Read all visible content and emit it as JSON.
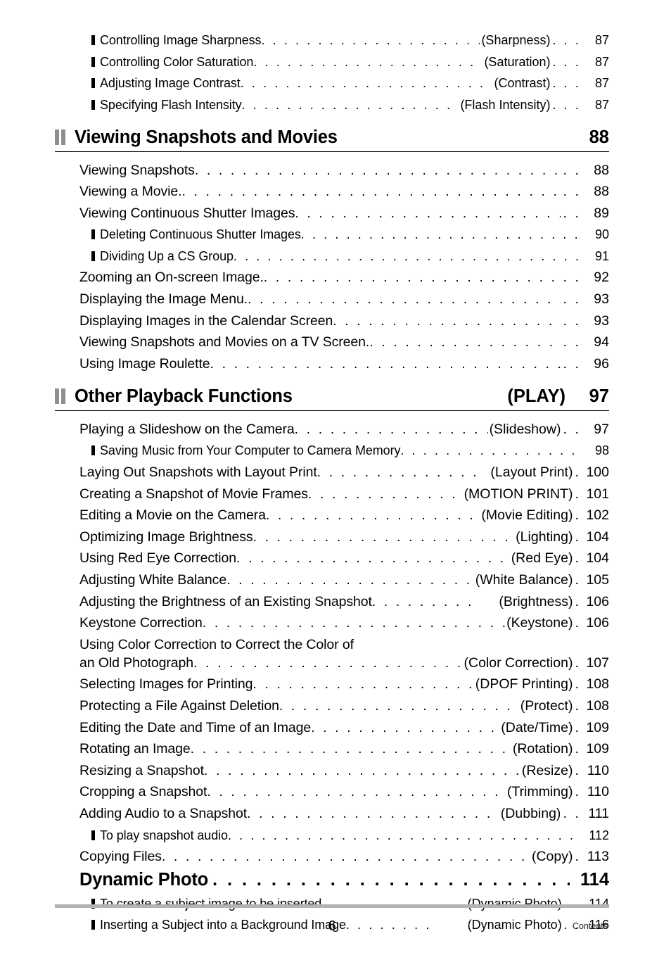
{
  "document": {
    "page_number": "6",
    "footer_label": "Contents"
  },
  "icons": {
    "section_marker": "double-bar-icon",
    "bullet": "filled-square-bullet-icon"
  },
  "colors": {
    "text": "#000000",
    "section_marker": "#8e8e8e",
    "footer_rule": "#b3b3b3",
    "rule": "#000000"
  },
  "top_entries": [
    {
      "label": "Controlling Image Sharpness",
      "ref": "(Sharpness)",
      "page": "87",
      "leader": ". . . . . . . . . . . . . . . . . . . . . . . .",
      "tail": ". . ."
    },
    {
      "label": "Controlling Color Saturation",
      "ref": "(Saturation)",
      "page": "87",
      "leader": ". . . . . . . . . . . . . . . . . . . . . . . . .",
      "tail": ". . ."
    },
    {
      "label": "Adjusting Image Contrast",
      "ref": "(Contrast)",
      "page": "87",
      "leader": ". . . . . . . . . . . . . . . . . . . . . . . . . . . . .",
      "tail": ". . ."
    },
    {
      "label": "Specifying Flash Intensity",
      "ref": "(Flash Intensity)",
      "page": "87",
      "leader": ". . . . . . . . . . . . . . . . . . . . . .",
      "tail": ". . ."
    }
  ],
  "sections": [
    {
      "title": "Viewing Snapshots and Movies",
      "ref": "",
      "page": "88",
      "entries": [
        {
          "level": 1,
          "label": "Viewing Snapshots",
          "ref": "",
          "page": "88",
          "leader": ". . . . . . . . . . . . . . . . . . . . . . . . . . . . . . . . . . . . . . . . . . . . . .",
          "tail": ". ."
        },
        {
          "level": 1,
          "label": "Viewing a Movie.",
          "ref": "",
          "page": "88",
          "leader": ". . . . . . . . . . . . . . . . . . . . . . . . . . . . . . . . . . . . . . . . . . . . . .",
          "tail": ". ."
        },
        {
          "level": 1,
          "label": "Viewing Continuous Shutter Images",
          "ref": "",
          "page": "89",
          "leader": ". . . . . . . . . . . . . . . . . . . . . . . . . . . . . .",
          "tail": ". ."
        },
        {
          "level": 2,
          "label": "Deleting Continuous Shutter Images",
          "ref": "",
          "page": "90",
          "leader": ". . . . . . . . . . . . . . . . . . . . . . . . . . . . . . .",
          "tail": ""
        },
        {
          "level": 2,
          "label": "Dividing Up a CS Group",
          "ref": "",
          "page": "91",
          "leader": ". . . . . . . . . . . . . . . . . . . . . . . . . . . . . . . . . . . . . . . . .",
          "tail": ""
        },
        {
          "level": 1,
          "label": "Zooming an On-screen Image.",
          "ref": "",
          "page": "92",
          "leader": ". . . . . . . . . . . . . . . . . . . . . . . . . . . . . . .",
          "tail": ". ."
        },
        {
          "level": 1,
          "label": "Displaying the Image Menu.",
          "ref": "",
          "page": "93",
          "leader": ". . . . . . . . . . . . . . . . . . . . . . . . . . . . . . . .",
          "tail": ". ."
        },
        {
          "level": 1,
          "label": "Displaying Images in the Calendar Screen",
          "ref": "",
          "page": "93",
          "leader": ". . . . . . . . . . . . . . . . . . . . . . . . .",
          "tail": ". ."
        },
        {
          "level": 1,
          "label": "Viewing Snapshots and Movies on a TV Screen.",
          "ref": "",
          "page": "94",
          "leader": ". . . . . . . . . . . . . . . . . . . .",
          "tail": ". ."
        },
        {
          "level": 1,
          "label": "Using Image Roulette",
          "ref": "",
          "page": "96",
          "leader": ". . . . . . . . . . . . . . . . . . . . . . . . . . . . . . . . . . . . . . . . . . . .",
          "tail": ". ."
        }
      ]
    },
    {
      "title": "Other Playback Functions",
      "ref": "(PLAY)",
      "page": "97",
      "entries": [
        {
          "level": 1,
          "label": "Playing a Slideshow on the Camera",
          "ref": "(Slideshow)",
          "page": "97",
          "leader": ". . . . . . . . . . . . . . . . . . .",
          "tail": ". ."
        },
        {
          "level": 2,
          "label": "Saving Music from Your Computer to Camera Memory",
          "ref": "",
          "page": "98",
          "leader": ". . . . . . . . . . . . . . . . . . .",
          "tail": ""
        },
        {
          "level": 1,
          "label": "Laying Out Snapshots with Layout Print",
          "ref": "(Layout Print)",
          "page": "100",
          "leader": ". . . . . . . . . . . . . .",
          "tail": "."
        },
        {
          "level": 1,
          "label": "Creating a Snapshot of Movie Frames",
          "ref": "(MOTION PRINT)",
          "page": "101",
          "leader": ". . . . . . . . . . . . .",
          "tail": "."
        },
        {
          "level": 1,
          "label": "Editing a Movie on the Camera",
          "ref": "(Movie Editing)",
          "page": "102",
          "leader": ". . . . . . . . . . . . . . . . . . .",
          "tail": "."
        },
        {
          "level": 1,
          "label": "Optimizing Image Brightness",
          "ref": "(Lighting)",
          "page": "104",
          "leader": ". . . . . . . . . . . . . . . . . . . . . . . . . . . .",
          "tail": "."
        },
        {
          "level": 1,
          "label": "Using Red Eye Correction",
          "ref": "(Red Eye)",
          "page": "104",
          "leader": ". . . . . . . . . . . . . . . . . . . . . . . . . . . . .",
          "tail": "."
        },
        {
          "level": 1,
          "label": "Adjusting White Balance",
          "ref": "(White Balance)",
          "page": "105",
          "leader": ". . . . . . . . . . . . . . . . . . . . . . . .",
          "tail": "."
        },
        {
          "level": 1,
          "label": "Adjusting the Brightness of an Existing Snapshot",
          "ref": "(Brightness)",
          "page": "106",
          "leader": ". . . . . . . . .",
          "tail": "."
        },
        {
          "level": 1,
          "label": "Keystone Correction",
          "ref": "(Keystone)",
          "page": "106",
          "leader": ". . . . . . . . . . . . . . . . . . . . . . . . . . . . . . . . .",
          "tail": "."
        },
        {
          "level": 1,
          "label": "an Old Photograph",
          "ref": "(Color Correction)",
          "page": "107",
          "leader": ". . . . . . . . . . . . . . . . . . . . . . . . . . . .",
          "tail": ".",
          "firstline": "Using Color Correction to Correct the Color of"
        },
        {
          "level": 1,
          "label": "Selecting Images for Printing",
          "ref": "(DPOF Printing)",
          "page": "108",
          "leader": ". . . . . . . . . . . . . . . . . . . . .",
          "tail": "."
        },
        {
          "level": 1,
          "label": "Protecting a File Against Deletion",
          "ref": "(Protect)",
          "page": "108",
          "leader": ". . . . . . . . . . . . . . . . . . . . . . .",
          "tail": "."
        },
        {
          "level": 1,
          "label": "Editing the Date and Time of an Image",
          "ref": "(Date/Time)",
          "page": "109",
          "leader": ". . . . . . . . . . . . . . . .",
          "tail": "."
        },
        {
          "level": 1,
          "label": "Rotating an Image",
          "ref": "(Rotation)",
          "page": "109",
          "leader": ". . . . . . . . . . . . . . . . . . . . . . . . . . . . . . . . . .",
          "tail": "."
        },
        {
          "level": 1,
          "label": "Resizing a Snapshot",
          "ref": "(Resize)",
          "page": "110",
          "leader": ". . . . . . . . . . . . . . . . . . . . . . . . . . . . . . . . . . . .",
          "tail": "."
        },
        {
          "level": 1,
          "label": "Cropping a Snapshot",
          "ref": "(Trimming)",
          "page": "110",
          "leader": ". . . . . . . . . . . . . . . . . . . . . . . . . . . . . . . .",
          "tail": "."
        },
        {
          "level": 1,
          "label": "Adding Audio to a Snapshot",
          "ref": "(Dubbing)",
          "page": "111",
          "leader": ". . . . . . . . . . . . . . . . . . . . . . . . . . . .",
          "tail": ". ."
        },
        {
          "level": 2,
          "label": "To play snapshot audio",
          "ref": "",
          "page": "112",
          "leader": ". . . . . . . . . . . . . . . . . . . . . . . . . . . . . . . . . . . . . . . . . . . .",
          "tail": ""
        },
        {
          "level": 1,
          "label": "Copying Files",
          "ref": "(Copy)",
          "page": "113",
          "leader": ". . . . . . . . . . . . . . . . . . . . . . . . . . . . . . . . . . . . . . . . . .",
          "tail": "."
        }
      ],
      "subheading": {
        "label": "Dynamic Photo",
        "page": "114",
        "leader": ". . . . . . . . . . . . . . . . . . . . . . . . . . ."
      },
      "sub_entries": [
        {
          "level": 2,
          "label": "To create a subject image to be inserted",
          "ref": "(Dynamic Photo)",
          "page": "114",
          "leader": ". . . . . . . . . . . .",
          "tail": ". ."
        },
        {
          "level": 2,
          "label": "Inserting a Subject into a Background Image",
          "ref": "(Dynamic Photo)",
          "page": "116",
          "leader": ". . . . . . . .",
          "tail": ". ."
        }
      ]
    }
  ]
}
